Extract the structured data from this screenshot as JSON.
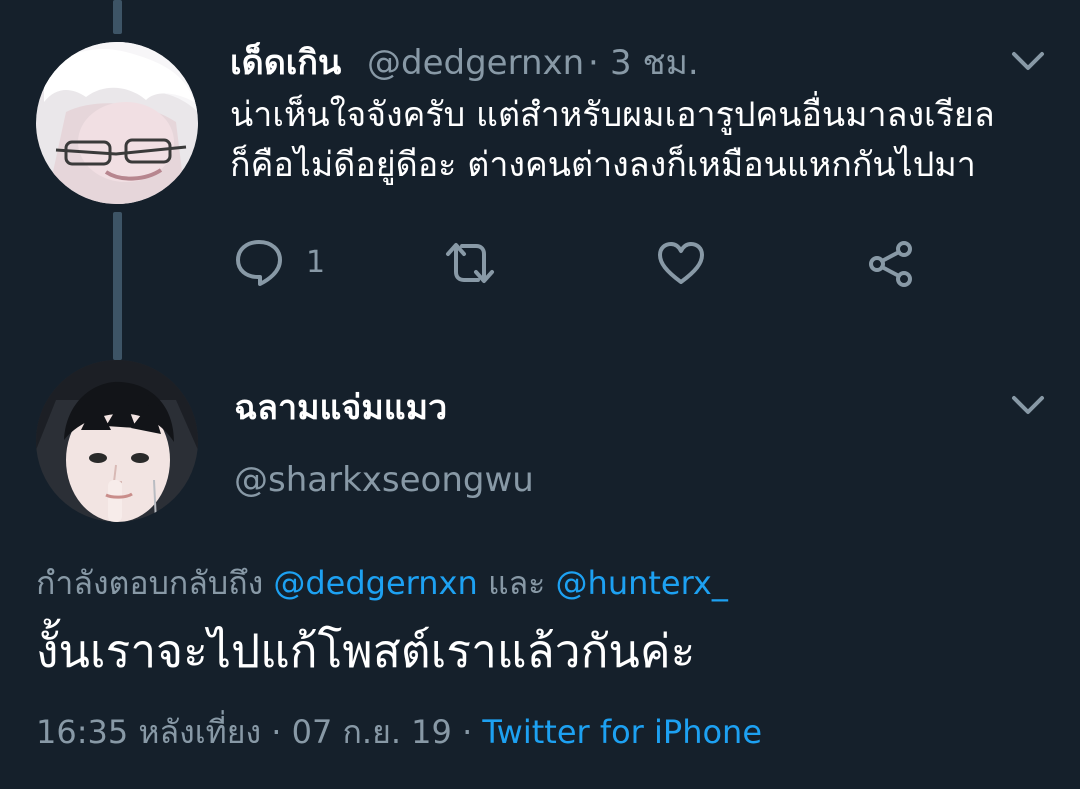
{
  "first_tweet": {
    "display_name": "เด็ดเกิน",
    "handle": "@dedgernxn",
    "separator": "·",
    "time_ago": "3 ชม.",
    "text_line_1": "น่าเห็นใจจังครับ แต่สำหรับผมเอารูปคนอื่นมาลงเรียล",
    "text_line_2": "ก็คือไม่ดีอยู่ดีอะ ต่างคนต่างลงก็เหมือนแหกกันไปมา",
    "reply_count": "1",
    "avatar_icon": "avatar-white-hair-glasses-icon",
    "menu_icon": "chevron-down-icon"
  },
  "main_tweet": {
    "display_name": "ฉลามแจ่มแมว",
    "handle": "@sharkxseongwu",
    "avatar_icon": "avatar-dark-hair-icon",
    "menu_icon": "chevron-down-icon",
    "replying_prefix": "กำลังตอบกลับถึง",
    "replying_user_1": "@dedgernxn",
    "replying_joiner": "และ",
    "replying_user_2": "@hunterx_",
    "text": "งั้นเราจะไปแก้โพสต์เราแล้วกันค่ะ",
    "time": "16:35 หลังเที่ยง",
    "separator_1": "·",
    "date": "07 ก.ย. 19",
    "separator_2": "·",
    "source": "Twitter for iPhone"
  },
  "colors": {
    "background": "#15202b",
    "muted_text": "#8899a6",
    "link": "#1da1f2",
    "thread_line": "#3d5466"
  }
}
